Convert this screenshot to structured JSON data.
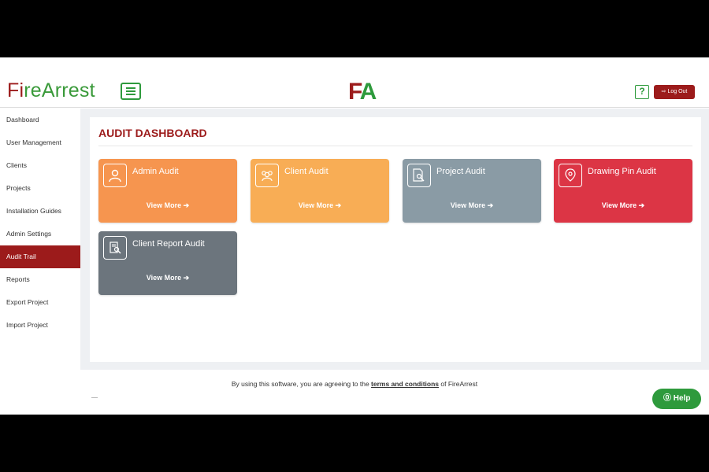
{
  "header": {
    "logo_text": {
      "fi_1": "F",
      "fi_2": "i",
      "rest": "reArrest"
    },
    "center_mark": {
      "first": "F",
      "second": "A"
    },
    "help_icon_label": "?",
    "logout_label": "⇨ Log Out"
  },
  "sidebar": {
    "items": [
      {
        "label": "Dashboard"
      },
      {
        "label": "User Management"
      },
      {
        "label": "Clients"
      },
      {
        "label": "Projects"
      },
      {
        "label": "Installation Guides"
      },
      {
        "label": "Admin Settings"
      },
      {
        "label": "Audit Trail",
        "active": true
      },
      {
        "label": "Reports"
      },
      {
        "label": "Export Project"
      },
      {
        "label": "Import Project"
      }
    ]
  },
  "main": {
    "title": "AUDIT DASHBOARD",
    "cards": [
      {
        "title": "Admin Audit",
        "link": "View More ➔",
        "color": "#f6954f",
        "icon": "user-icon"
      },
      {
        "title": "Client Audit",
        "link": "View More ➔",
        "color": "#f8ad55",
        "icon": "group-icon"
      },
      {
        "title": "Project Audit",
        "link": "View More ➔",
        "color": "#8a9ba5",
        "icon": "document-search-icon"
      },
      {
        "title": "Drawing Pin Audit",
        "link": "View More ➔",
        "color": "#dc3545",
        "icon": "map-pin-icon"
      },
      {
        "title": "Client Report Audit",
        "link": "View More ➔",
        "color": "#6c757d",
        "icon": "report-search-icon"
      }
    ]
  },
  "footer": {
    "text_before": "By using this software, you are agreeing to the ",
    "link": "terms and conditions",
    "text_after": " of FireArrest"
  },
  "help_button": {
    "label": "Help"
  },
  "colors": {
    "brand_red": "#9c1b1b",
    "brand_green": "#2e9a3c"
  }
}
